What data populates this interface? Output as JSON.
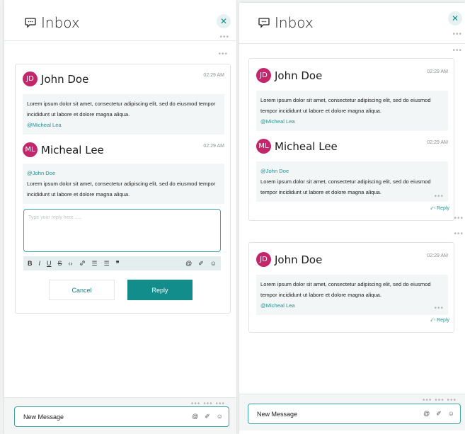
{
  "header": {
    "title": "Inbox",
    "close_icon": "✕"
  },
  "left": {
    "messages": [
      {
        "initials": "JD",
        "author": "John Doe",
        "time": "02:29 AM",
        "text": "Lorem ipsum dolor sit amet, consectetur adipiscing elit, sed do eiusmod tempor incididunt ut labore et dolore magna aliqua.",
        "mention": "@Micheal Lea"
      },
      {
        "initials": "ML",
        "author": "Micheal Lee",
        "time": "02:29 AM",
        "mention": "@John Doe",
        "text": "Lorem ipsum dolor sit amet, consectetur adipiscing elit, sed do eiusmod tempor incididunt ut labore et dolore magna aliqua."
      }
    ],
    "reply_placeholder": "Type your reply here .....",
    "cancel_label": "Cancel",
    "reply_label": "Reply"
  },
  "toolbar": {
    "bold": "B",
    "italic": "I",
    "underline": "U",
    "strike": "S",
    "code": "‹›",
    "link": "🔗",
    "ordered_list": "☰",
    "bullet_list": "☰",
    "quote": "❞",
    "mention": "@",
    "attach": "✐",
    "emoji": "☺"
  },
  "right": {
    "thread1": [
      {
        "initials": "JD",
        "author": "John Doe",
        "time": "02:29 AM",
        "text": "Lorem ipsum dolor sit amet, consectetur adipiscing elit, sed do eiusmod tempor incididunt ut labore et dolore magna aliqua.",
        "mention": "@Micheal Lea"
      },
      {
        "initials": "ML",
        "author": "Micheal Lee",
        "time": "02:29 AM",
        "mention": "@John Doe",
        "text": "Lorem ipsum dolor sit amet, consectetur adipiscing elit, sed do eiusmod tempor incididunt ut labore et dolore magna aliqua."
      }
    ],
    "thread2": [
      {
        "initials": "JD",
        "author": "John Doe",
        "time": "02:29 AM",
        "text": "Lorem ipsum dolor sit amet, consectetur adipiscing elit, sed do eiusmod tempor incididunt ut labore et dolore magna aliqua.",
        "mention": "@Micheal Lea"
      }
    ],
    "reply_link": "⤺ Reply"
  },
  "footer": {
    "new_message_label": "New Message"
  },
  "colors": {
    "accent": "#138c8c",
    "avatar": "#c2276b"
  }
}
